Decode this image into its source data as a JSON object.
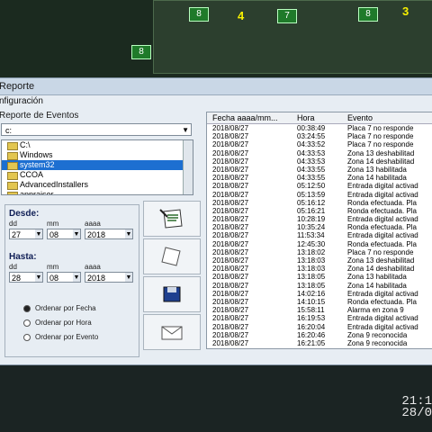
{
  "background": {
    "map_tags": [
      "8",
      "7",
      "8",
      "8"
    ],
    "map_numbers": [
      "4",
      "3"
    ],
    "clock_time": "21:1",
    "clock_date": "28/0"
  },
  "window": {
    "title": "Reporte",
    "config_tab": "nfiguración",
    "events_group": "Reporte de Eventos",
    "drive": "c:",
    "folders": [
      "C:\\",
      "Windows",
      "system32",
      "CCOA",
      "AdvancedInstallers",
      "appraiser"
    ],
    "selected_folder_index": 2
  },
  "date_range": {
    "desde_label": "Desde:",
    "hasta_label": "Hasta:",
    "dd_label": "dd",
    "mm_label": "mm",
    "aaaa_label": "aaaa",
    "desde": {
      "dd": "27",
      "mm": "08",
      "aaaa": "2018"
    },
    "hasta": {
      "dd": "28",
      "mm": "08",
      "aaaa": "2018"
    }
  },
  "sort_options": {
    "items": [
      "Ordenar por Fecha",
      "Ordenar por Hora",
      "Ordenar por Evento"
    ],
    "selected_index": 0
  },
  "list": {
    "headers": [
      "Fecha aaaa/mm...",
      "Hora",
      "Evento"
    ],
    "rows": [
      [
        "2018/08/27",
        "00:38:49",
        "Placa 7 no responde"
      ],
      [
        "2018/08/27",
        "03:24:55",
        "Placa 7 no responde"
      ],
      [
        "2018/08/27",
        "04:33:52",
        "Placa 7 no responde"
      ],
      [
        "2018/08/27",
        "04:33:53",
        "Zona 13 deshabilitad"
      ],
      [
        "2018/08/27",
        "04:33:53",
        "Zona 14 deshabilitad"
      ],
      [
        "2018/08/27",
        "04:33:55",
        "Zona 13 habilitada"
      ],
      [
        "2018/08/27",
        "04:33:55",
        "Zona 14 habilitada"
      ],
      [
        "2018/08/27",
        "05:12:50",
        "Entrada digital activad"
      ],
      [
        "2018/08/27",
        "05:13:59",
        "Entrada digital activad"
      ],
      [
        "2018/08/27",
        "05:16:12",
        "Ronda efectuada. Pla"
      ],
      [
        "2018/08/27",
        "05:16:21",
        "Ronda efectuada. Pla"
      ],
      [
        "2018/08/27",
        "10:28:19",
        "Entrada digital activad"
      ],
      [
        "2018/08/27",
        "10:35:24",
        "Ronda efectuada. Pla"
      ],
      [
        "2018/08/27",
        "11:53:34",
        "Entrada digital activad"
      ],
      [
        "2018/08/27",
        "12:45:30",
        "Ronda efectuada. Pla"
      ],
      [
        "2018/08/27",
        "13:18:02",
        "Placa 7 no responde"
      ],
      [
        "2018/08/27",
        "13:18:03",
        "Zona 13 deshabilitad"
      ],
      [
        "2018/08/27",
        "13:18:03",
        "Zona 14 deshabilitad"
      ],
      [
        "2018/08/27",
        "13:18:05",
        "Zona 13 habilitada"
      ],
      [
        "2018/08/27",
        "13:18:05",
        "Zona 14 habilitada"
      ],
      [
        "2018/08/27",
        "14:02:16",
        "Entrada digital activad"
      ],
      [
        "2018/08/27",
        "14:10:15",
        "Ronda efectuada. Pla"
      ],
      [
        "2018/08/27",
        "15:58:11",
        "Alarma en zona 9"
      ],
      [
        "2018/08/27",
        "16:19:53",
        "Entrada digital activad"
      ],
      [
        "2018/08/27",
        "16:20:04",
        "Entrada digital activad"
      ],
      [
        "2018/08/27",
        "16:20:46",
        "Zona 9 reconocida"
      ],
      [
        "2018/08/27",
        "16:21:05",
        "Zona 9 reconocida"
      ]
    ]
  }
}
